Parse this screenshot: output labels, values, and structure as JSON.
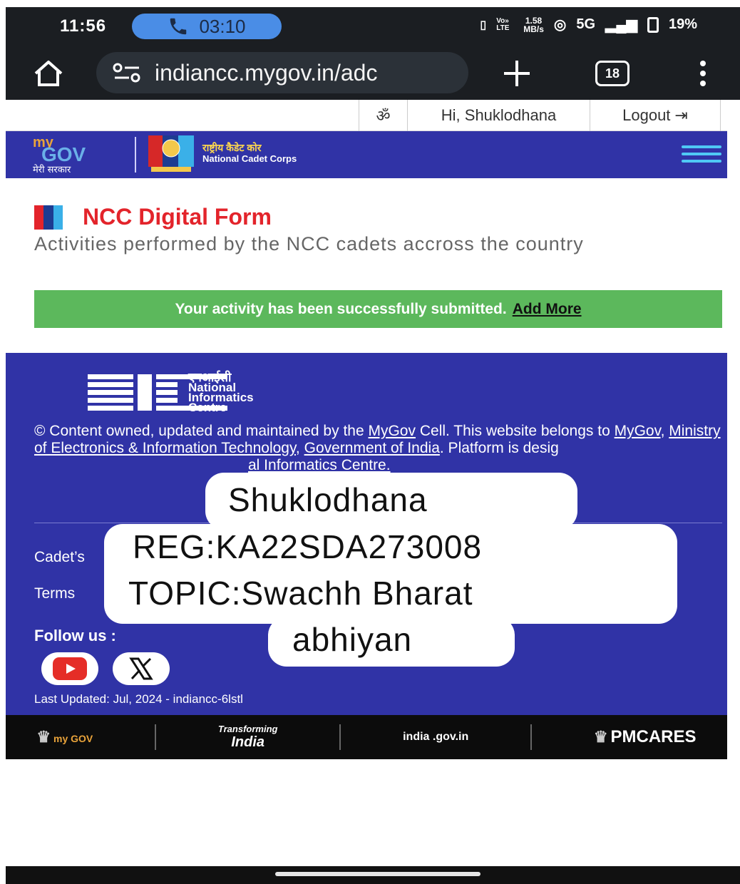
{
  "status_bar": {
    "time": "11:56",
    "call_timer": "03:10",
    "network_speed_value": "1.58",
    "network_speed_unit": "MB/s",
    "network_type": "5G",
    "battery": "19%",
    "volte_label": "Vo» LTE"
  },
  "browser": {
    "url": "indiancc.mygov.in/adc",
    "tab_count": "18"
  },
  "site_header": {
    "accessibility_symbol": "ॐ",
    "greeting": "Hi, Shuklodhana",
    "logout_label": "Logout",
    "brand_hindi": "मेरी सरकार",
    "ncc_hindi": "राष्ट्रीय कैडेट कोर",
    "ncc_english": "National Cadet Corps"
  },
  "main": {
    "title": "NCC Digital Form",
    "subtitle": "Activities performed by the NCC cadets accross the country",
    "success_message": "Your activity has been successfully submitted.",
    "add_more_label": "Add More"
  },
  "footer": {
    "nic_hindi": "एनआईसी",
    "nic_line1": "National",
    "nic_line2": "Informatics",
    "nic_line3": "Centre",
    "copy_1": "© Content owned, updated and maintained by the",
    "link_mygov_1": "MyGov",
    "copy_2": "Cell. This website belongs to",
    "link_mygov_2": "MyGov",
    "copy_3": ",",
    "link_meity": "Ministry of Electronics & Information Technology",
    "copy_4": ",",
    "link_goi": "Government of India",
    "copy_5": ". Platform is desig",
    "link_nic_partial": "al Informatics Centre.",
    "cadet_link_partial": "Cadet’s",
    "terms_link_partial": "Terms",
    "follow_label": "Follow us :",
    "last_updated": "Last Updated: Jul, 2024 - indiancc-6lstl"
  },
  "partners": {
    "mygov": "my GOV",
    "transforming": "Transforming",
    "india": "India",
    "india_gov": "india .gov.in",
    "pmcares": "PMCARES"
  },
  "overlay_sticker": {
    "line1": "Shuklodhana",
    "line2": "REG:KA22SDA273008",
    "line3": "TOPIC:Swachh Bharat",
    "line4": "abhiyan"
  },
  "colors": {
    "nav_blue": "#3033a6",
    "title_red": "#e3242b",
    "success_green": "#5cb85c",
    "hamburger_cyan": "#4fc8f5"
  }
}
